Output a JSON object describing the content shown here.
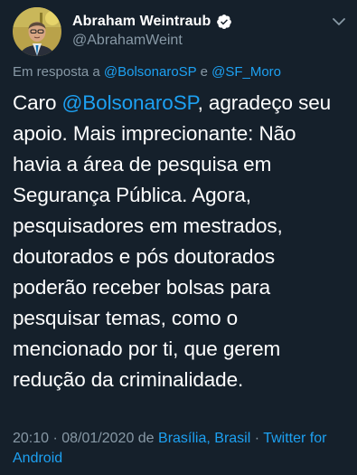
{
  "author": {
    "display_name": "Abraham Weintraub",
    "handle": "@AbrahamWeint",
    "verified": true
  },
  "reply": {
    "prefix": "Em resposta a ",
    "mention1": "@BolsonaroSP",
    "conjunction": " e ",
    "mention2": "@SF_Moro"
  },
  "body": {
    "line1_start": "Caro ",
    "line1_mention": "@BolsonaroSP",
    "line1_end": ", agradeço seu",
    "line2": "apoio. Mais imprecionante: Não",
    "line3": "havia a área de pesquisa em",
    "line4": "Segurança Pública. Agora,",
    "line5": "pesquisadores em mestrados,",
    "line6": "doutorados e pós doutorados",
    "line7": "poderão receber bolsas para",
    "line8": "pesquisar temas, como o",
    "line9": "mencionado por ti, que gerem",
    "line10": "redução da criminalidade."
  },
  "meta": {
    "time_date": "20:10 · 08/01/2020 de ",
    "location": "Brasília, Brasil",
    "separator": " · ",
    "client": "Twitter for Android"
  },
  "icons": {
    "avatar": "profile-photo",
    "verified": "verified-badge-icon",
    "menu": "chevron-down-icon"
  },
  "colors": {
    "background": "#15202b",
    "text_primary": "#ffffff",
    "text_secondary": "#8899a6",
    "accent": "#1da1f2"
  }
}
